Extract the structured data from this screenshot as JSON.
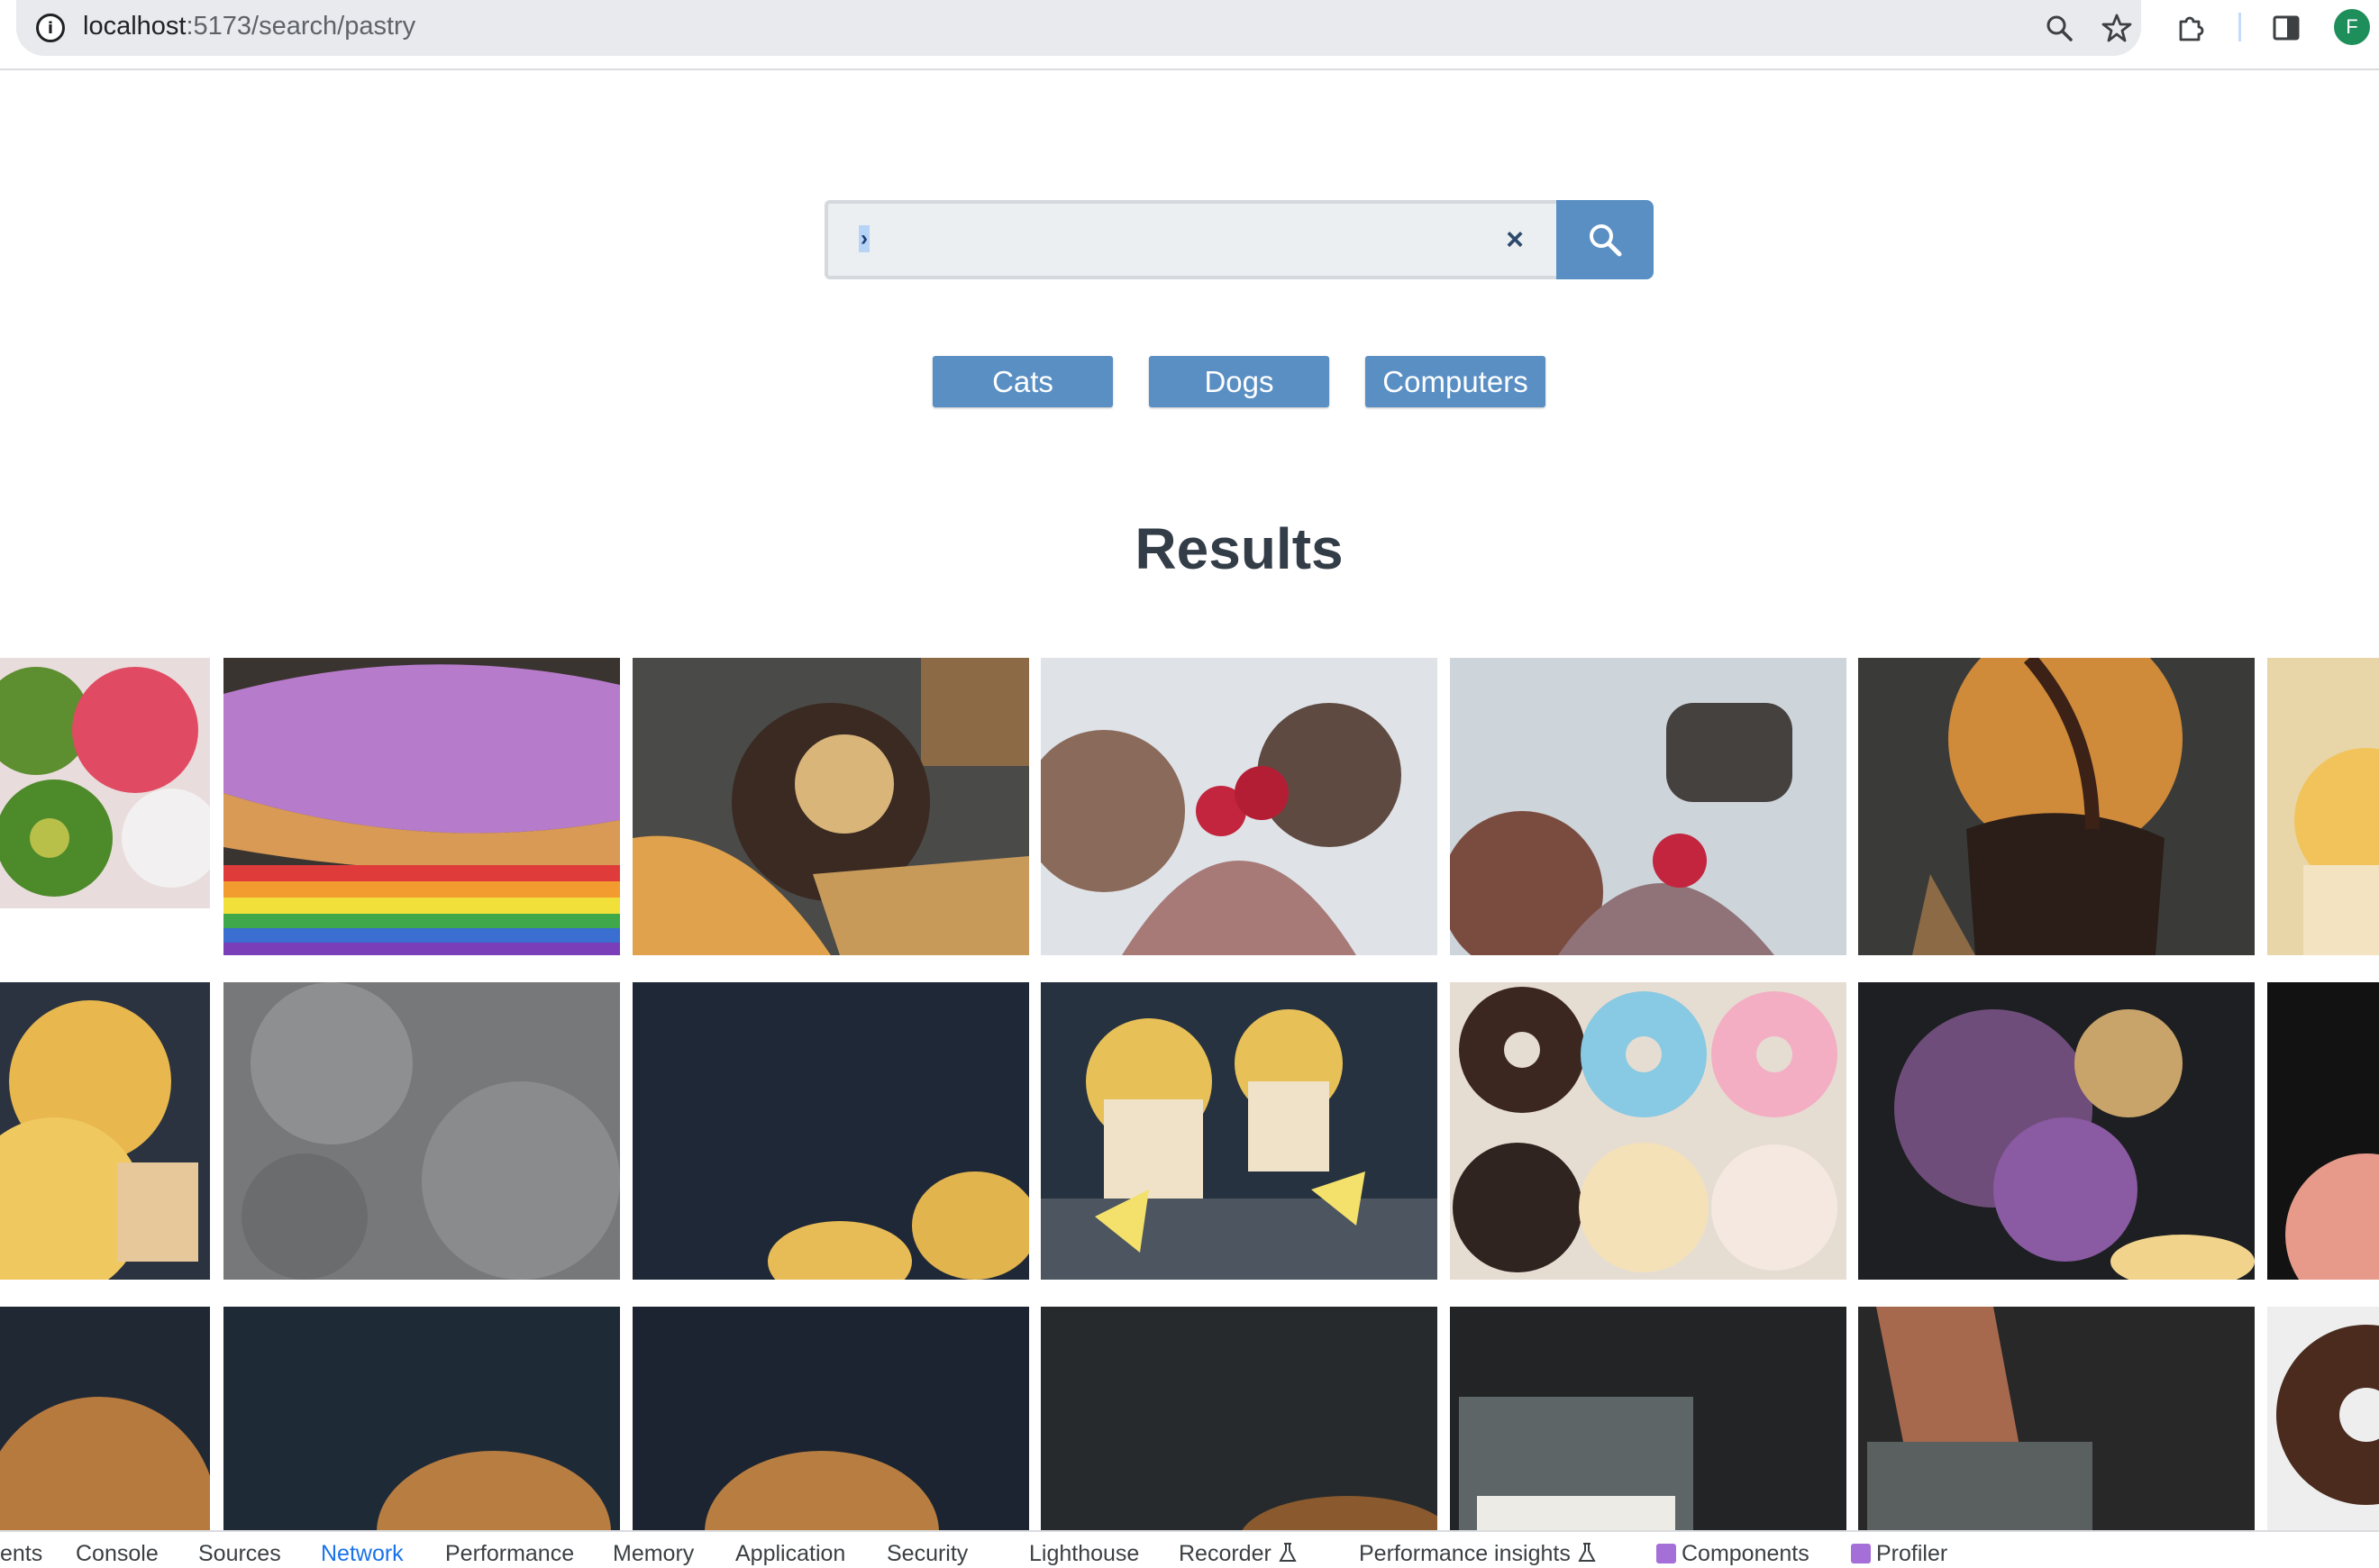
{
  "browser": {
    "url_host": "localhost",
    "url_path": ":5173/search/pastry",
    "profile_initial": "F"
  },
  "search": {
    "value": "",
    "caret_glyph": "›",
    "clear_glyph": "×"
  },
  "chips": [
    "Cats",
    "Dogs",
    "Computers"
  ],
  "results": {
    "title": "Results"
  },
  "devtools": {
    "tabs": [
      "ents",
      "Console",
      "Sources",
      "Network",
      "Performance",
      "Memory",
      "Application",
      "Security",
      "Lighthouse",
      "Recorder",
      "Performance insights",
      "Components",
      "Profiler"
    ],
    "active_tab": "Network"
  },
  "colors": {
    "accent": "#5a8fc4",
    "heading": "#333d47"
  },
  "icons": [
    "info-icon",
    "zoom-icon",
    "bookmark-star-icon",
    "extensions-icon",
    "side-panel-icon",
    "search-icon",
    "clear-icon",
    "flask-icon",
    "react-icon"
  ]
}
